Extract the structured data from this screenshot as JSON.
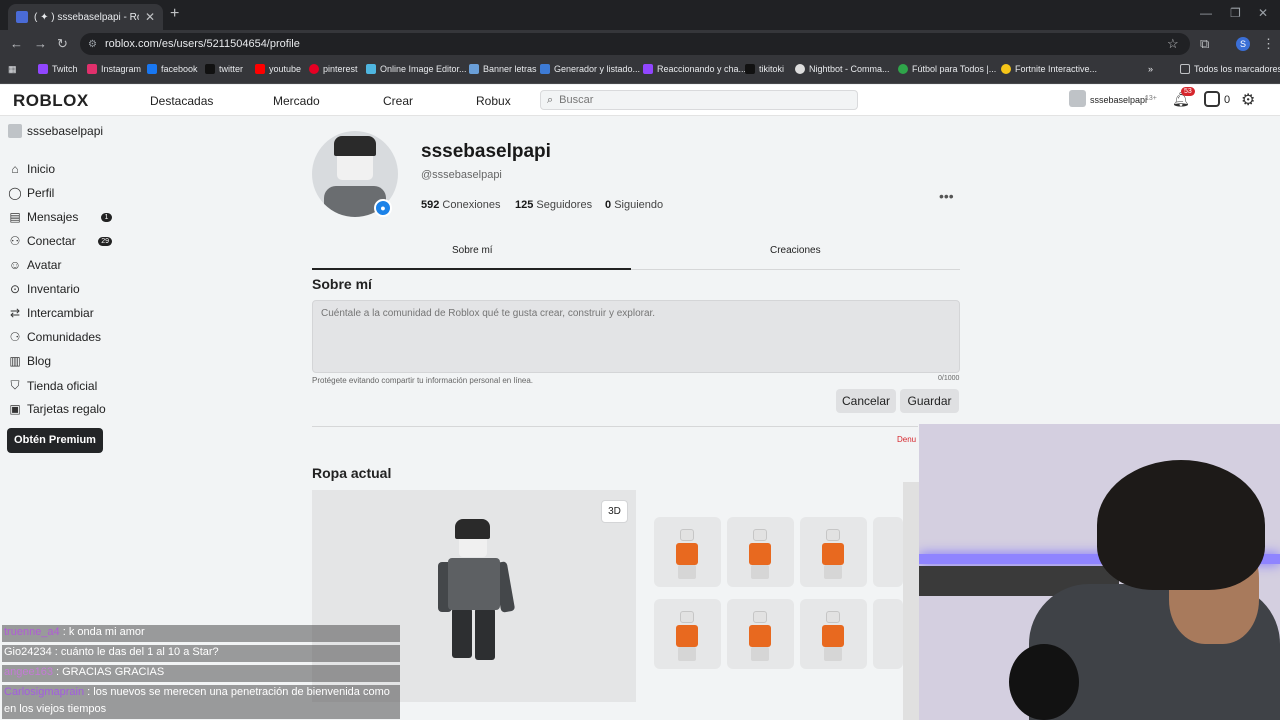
{
  "browser": {
    "tab_title": "( ✦ ) sssebaselpapi - Roblox",
    "url": "roblox.com/es/users/5211504654/profile",
    "profile_initial": "S",
    "bookmarks": [
      "Twitch",
      "Instagram",
      "facebook",
      "twitter",
      "youtube",
      "pinterest",
      "Online Image Editor...",
      "Banner letras",
      "Generador y listado...",
      "Reaccionando y cha...",
      "tikitoki",
      "Nightbot - Comma...",
      "Fútbol para Todos |...",
      "Fortnite Interactive..."
    ],
    "bookmarks_all": "Todos los marcadores"
  },
  "header": {
    "logo": "ROBLOX",
    "nav": [
      "Destacadas",
      "Mercado",
      "Crear",
      "Robux"
    ],
    "search_placeholder": "Buscar",
    "username": "sssebaselpapi",
    "age_tag": "13+",
    "notif_count": "53",
    "robux": "0"
  },
  "sidebar": {
    "username": "sssebaselpapi",
    "items": [
      {
        "label": "Inicio",
        "icon": "home-icon"
      },
      {
        "label": "Perfil",
        "icon": "person-icon"
      },
      {
        "label": "Mensajes",
        "icon": "message-icon",
        "badge": "1"
      },
      {
        "label": "Conectar",
        "icon": "people-icon",
        "badge": "29"
      },
      {
        "label": "Avatar",
        "icon": "avatar-icon"
      },
      {
        "label": "Inventario",
        "icon": "inventory-icon"
      },
      {
        "label": "Intercambiar",
        "icon": "trade-icon"
      },
      {
        "label": "Comunidades",
        "icon": "communities-icon"
      },
      {
        "label": "Blog",
        "icon": "blog-icon"
      },
      {
        "label": "Tienda oficial",
        "icon": "store-icon"
      },
      {
        "label": "Tarjetas regalo",
        "icon": "gift-card-icon"
      }
    ],
    "premium_label": "Obtén Premium"
  },
  "profile": {
    "display_name": "sssebaselpapi",
    "handle": "@sssebaselpapi",
    "stats": [
      {
        "value": "592",
        "label": "Conexiones"
      },
      {
        "value": "125",
        "label": "Seguidores"
      },
      {
        "value": "0",
        "label": "Siguiendo"
      }
    ],
    "tabs": [
      "Sobre mí",
      "Creaciones"
    ],
    "about_heading": "Sobre mí",
    "about_placeholder": "Cuéntale a la comunidad de Roblox qué te gusta crear, construir y explorar.",
    "about_note": "Protégete evitando compartir tu información personal en línea.",
    "char_count": "0/1000",
    "cancel_label": "Cancelar",
    "save_label": "Guardar",
    "report_label": "Denu",
    "outfit_heading": "Ropa actual",
    "btn_3d": "3D"
  },
  "chat": [
    {
      "user": "truenne_a4",
      "message": ": k onda mi amor",
      "color": "#b05cd6"
    },
    {
      "user": "Gio24234",
      "message": ": cuánto le das del 1 al 10 a Star?",
      "color": "#ffffff"
    },
    {
      "user": "angee163",
      "message": ": GRACIAS GRACIAS",
      "color": "#c47ad6"
    },
    {
      "user": "Carlosigmaprain",
      "message": ": los nuevos se merecen una penetración de bienvenida como",
      "color": "#a35ce0"
    },
    {
      "user": "",
      "message": "en los viejos tiempos",
      "color": "#ffffff"
    }
  ]
}
